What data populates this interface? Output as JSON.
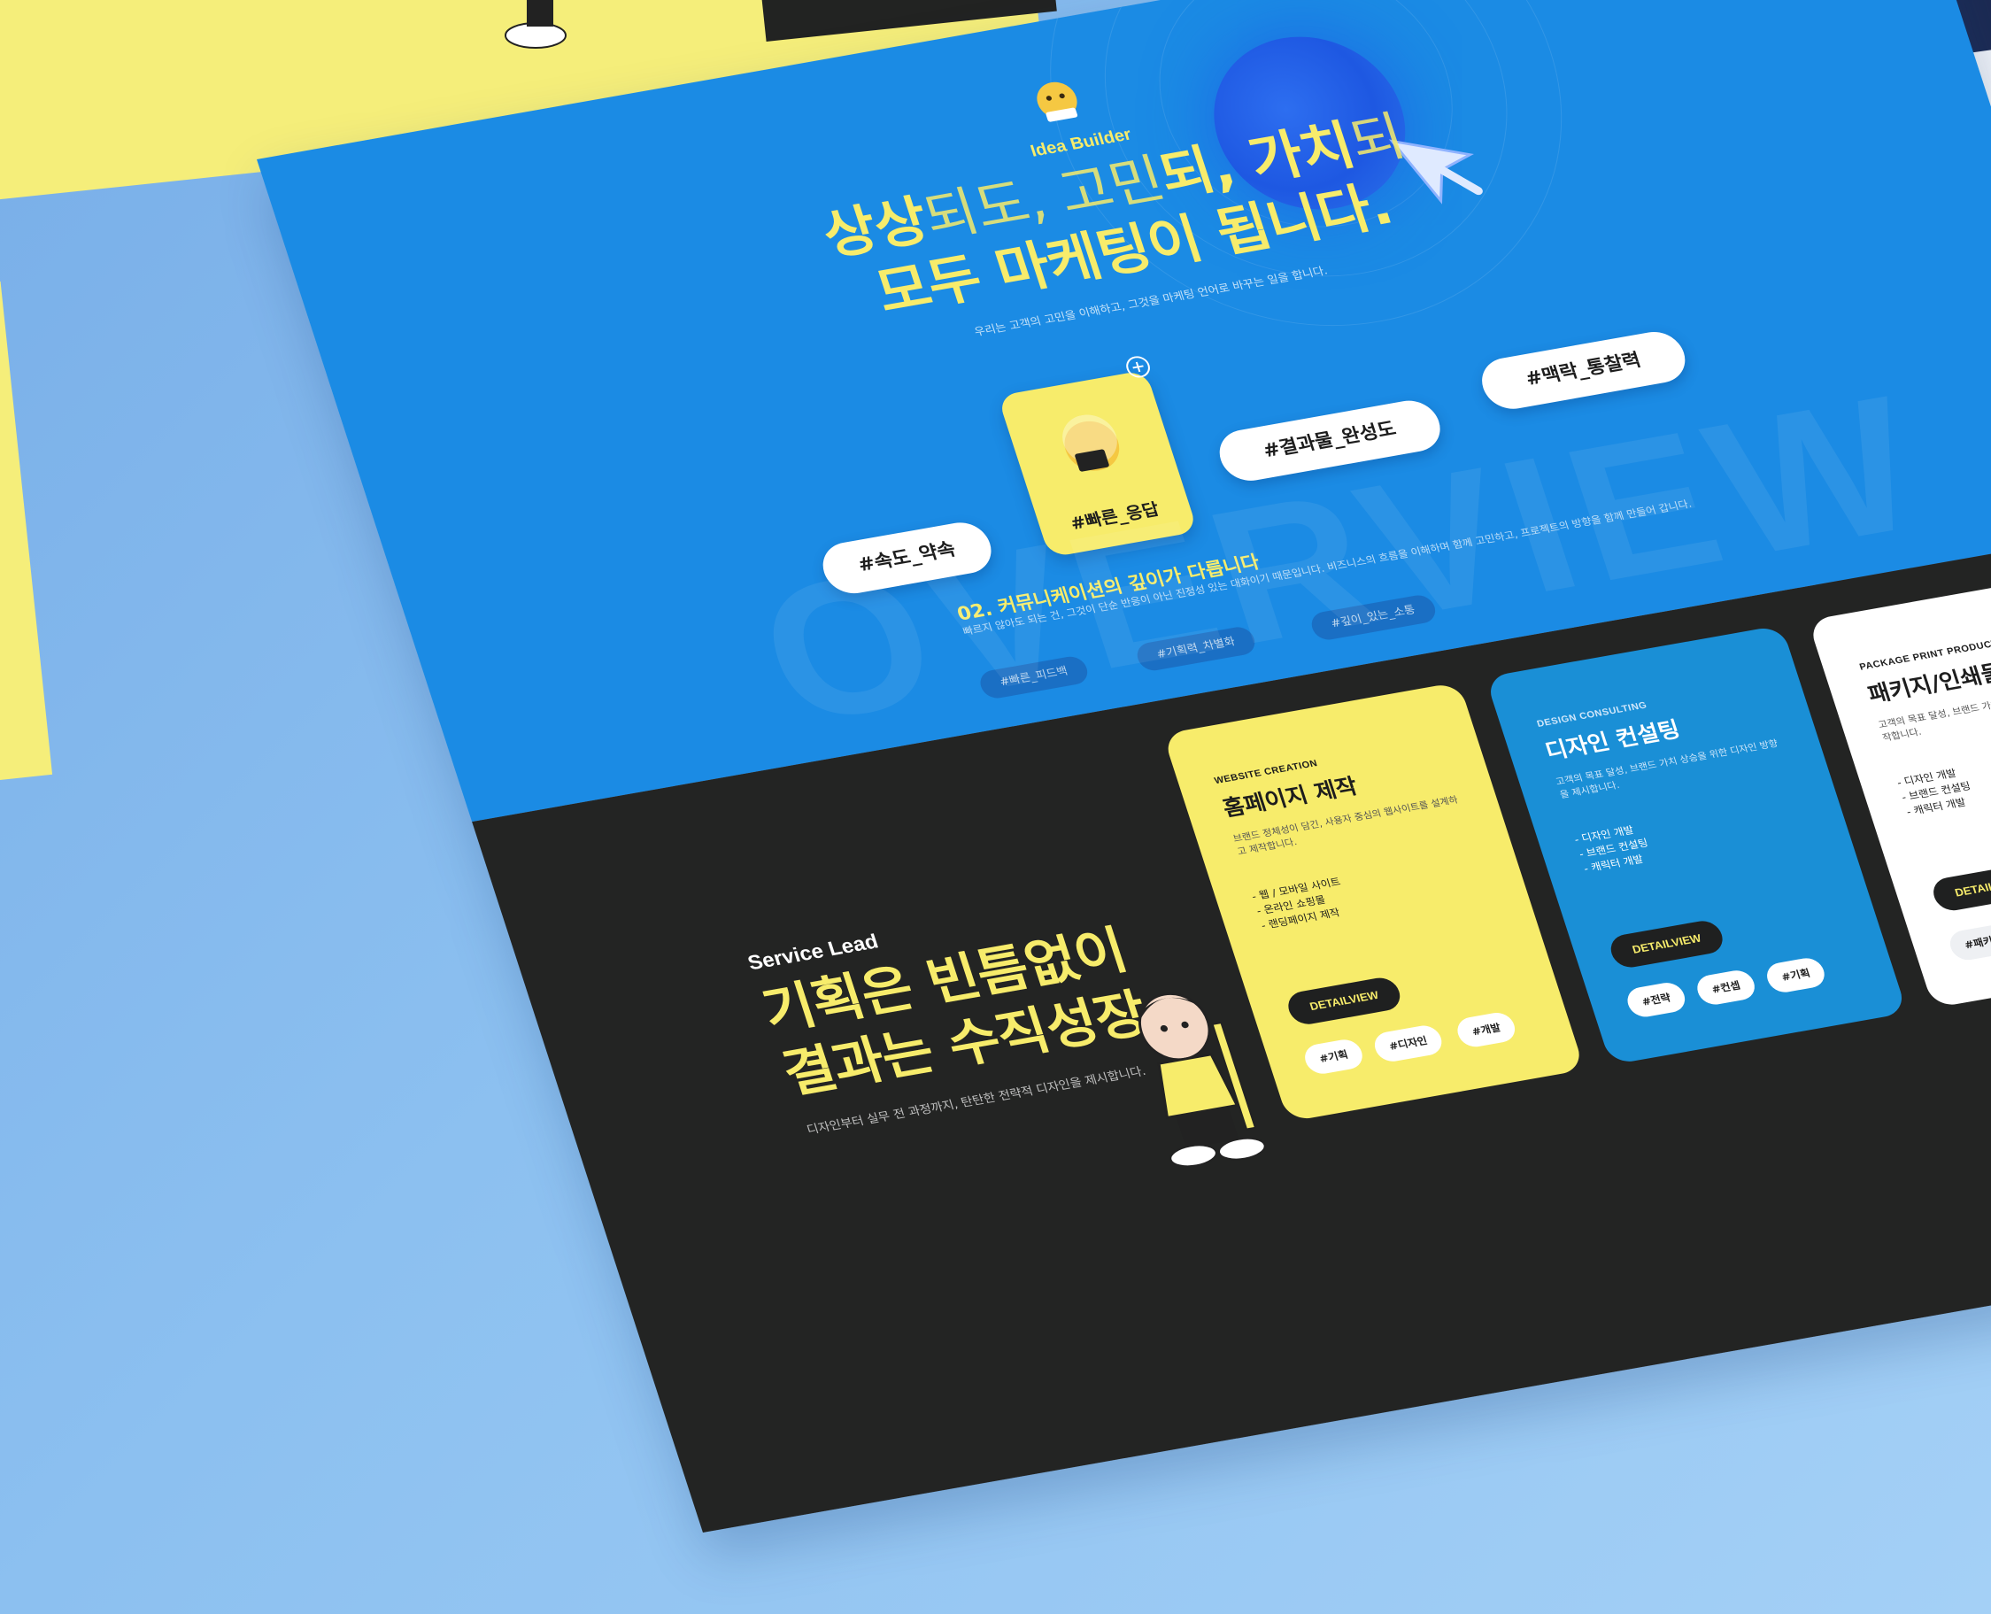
{
  "hero": {
    "brand": "Idea Builder",
    "headline_line1_a": "상상",
    "headline_line1_b": "되도, 고민",
    "headline_line1_c": "되, 가치",
    "headline_line1_d": "되",
    "headline_line2": "모두 마케팅이 됩니다.",
    "description": "우리는 고객의 고민을 이해하고, 그것을 마케팅 언어로 바꾸는 일을 합니다.",
    "tags": [
      "#속도_약속",
      "#빠른_응답",
      "#결과물_완성도",
      "#맥락_통찰력"
    ],
    "subtitle": "02. 커뮤니케이션의 깊이가 다릅니다",
    "sub_description": "빠르지 않아도 되는 건, 그것이 단순 반응이 아닌 진정성 있는 대화이기 때문입니다. 비즈니스의 흐름을 이해하며 함께 고민하고, 프로젝트의 방향을 함께 만들어 갑니다.",
    "small_tags": [
      "#빠른_피드백",
      "#기획력_차별화",
      "#깊이_있는_소통"
    ],
    "watermark": "OVERVIEW"
  },
  "service": {
    "eyebrow": "Service Lead",
    "headline_line1": "기획은 빈틈없이",
    "headline_line2": "결과는 수직성장",
    "description": "디자인부터 실무 전 과정까지, 탄탄한 전략적 디자인을 제시합니다.",
    "cards": [
      {
        "eyebrow": "WEBSITE CREATION",
        "title": "홈페이지 제작",
        "description": "브랜드 정체성이 담긴, 사용자 중심의 웹사이트를 설계하고 제작합니다.",
        "items": [
          "- 웹 / 모바일 사이트",
          "- 온라인 쇼핑몰",
          "- 랜딩페이지 제작"
        ],
        "button": "DETAILVIEW",
        "chips": [
          "#기획",
          "#디자인",
          "#개발"
        ]
      },
      {
        "eyebrow": "DESIGN CONSULTING",
        "title": "디자인 컨설팅",
        "description": "고객의 목표 달성, 브랜드 가치 상승을 위한 디자인 방향을 제시합니다.",
        "items": [
          "- 디자인 개발",
          "- 브랜드 컨설팅",
          "- 캐릭터 개발"
        ],
        "button": "DETAILVIEW",
        "chips": [
          "#전략",
          "#컨셉",
          "#기획"
        ]
      },
      {
        "eyebrow": "PACKAGE PRINT PRODUCTION",
        "title": "패키지/인쇄물 제작",
        "description": "고객의 목표 달성, 브랜드 가치 상승을 위한 인쇄물을 제작합니다.",
        "items": [
          "- 디자인 개발",
          "- 브랜드 컨설팅",
          "- 캐릭터 개발"
        ],
        "button": "DETAILVIEW",
        "chips": [
          "#패키지"
        ]
      }
    ]
  },
  "colors": {
    "hero_blue": "#1b8be4",
    "accent_yellow": "#f7ec6b",
    "dark": "#232423",
    "card_blue": "#1a8fd6"
  },
  "icons": [
    "emoji-face-icon",
    "cursor-icon",
    "plus-circle-icon",
    "mascot-character"
  ]
}
